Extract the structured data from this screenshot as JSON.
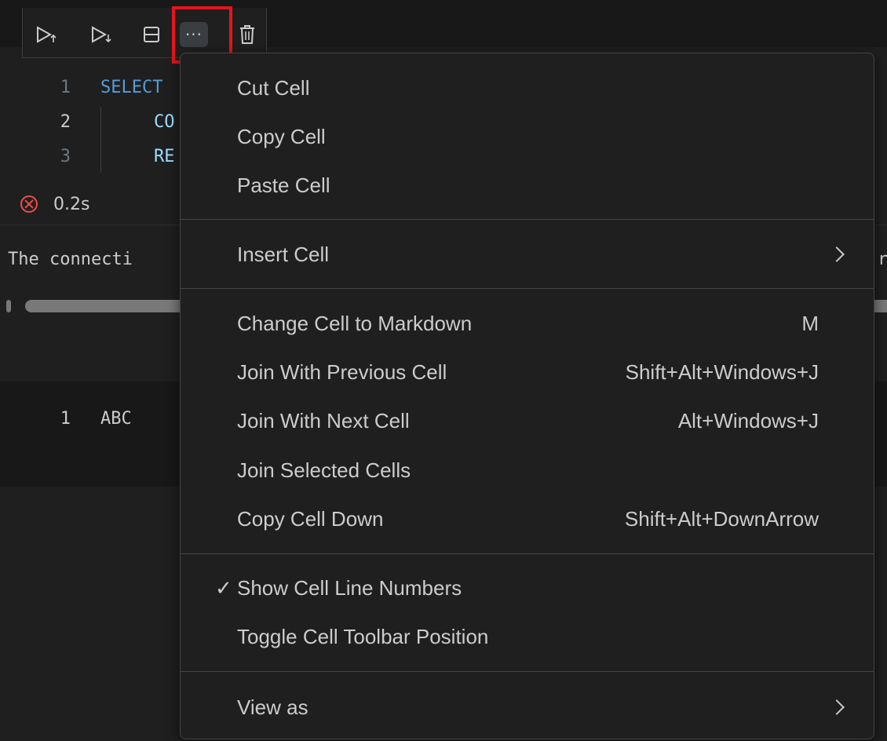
{
  "toolbar": {
    "run_above_label": "Execute Above Cells",
    "run_below_label": "Execute Cell and Below",
    "split_label": "Split Cell",
    "more_label": "···",
    "delete_label": "Delete Cell"
  },
  "editor": {
    "lines": [
      {
        "number": "1",
        "text": "SELECT"
      },
      {
        "number": "2",
        "text": "CO"
      },
      {
        "number": "3",
        "text": "RE"
      }
    ],
    "duration": "0.2s",
    "output_text": "The connecti",
    "output_text_right": "r",
    "result_rows": [
      {
        "number": "1",
        "value": "ABC"
      }
    ]
  },
  "menu": {
    "items": [
      {
        "label": "Cut Cell",
        "shortcut": "",
        "checked": false,
        "submenu": false
      },
      {
        "label": "Copy Cell",
        "shortcut": "",
        "checked": false,
        "submenu": false
      },
      {
        "label": "Paste Cell",
        "shortcut": "",
        "checked": false,
        "submenu": false
      },
      {
        "label": "Insert Cell",
        "shortcut": "",
        "checked": false,
        "submenu": true
      },
      {
        "label": "Change Cell to Markdown",
        "shortcut": "M",
        "checked": false,
        "submenu": false
      },
      {
        "label": "Join With Previous Cell",
        "shortcut": "Shift+Alt+Windows+J",
        "checked": false,
        "submenu": false
      },
      {
        "label": "Join With Next Cell",
        "shortcut": "Alt+Windows+J",
        "checked": false,
        "submenu": false
      },
      {
        "label": "Join Selected Cells",
        "shortcut": "",
        "checked": false,
        "submenu": false
      },
      {
        "label": "Copy Cell Down",
        "shortcut": "Shift+Alt+DownArrow",
        "checked": false,
        "submenu": false
      },
      {
        "label": "Show Cell Line Numbers",
        "shortcut": "",
        "checked": true,
        "check_mark": "✓",
        "submenu": false
      },
      {
        "label": "Toggle Cell Toolbar Position",
        "shortcut": "",
        "checked": false,
        "submenu": false
      },
      {
        "label": "View as",
        "shortcut": "",
        "checked": false,
        "submenu": true
      }
    ]
  },
  "colors": {
    "highlight": "#e4151b",
    "keyword": "#569cd6",
    "error": "#f14c4c"
  }
}
